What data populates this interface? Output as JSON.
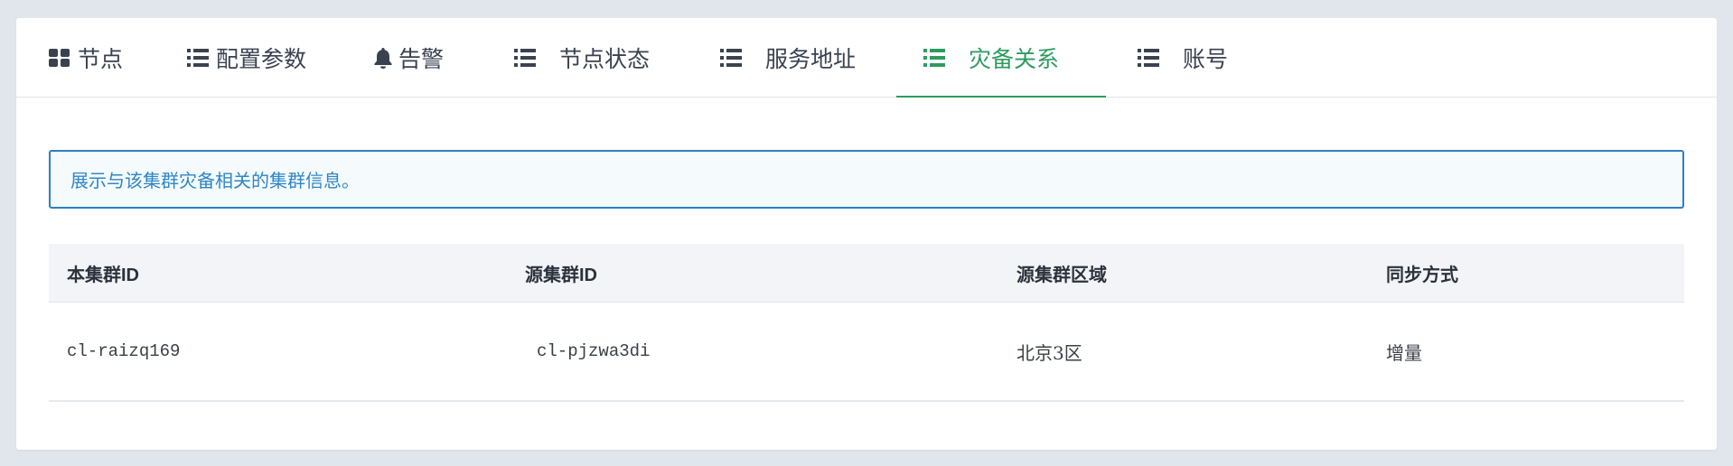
{
  "tabs": [
    {
      "label": "节点",
      "icon": "grid-icon",
      "active": false
    },
    {
      "label": "配置参数",
      "icon": "list-icon",
      "active": false
    },
    {
      "label": "告警",
      "icon": "bell-icon",
      "active": false
    },
    {
      "label": "节点状态",
      "icon": "list-icon",
      "active": false
    },
    {
      "label": "服务地址",
      "icon": "list-icon",
      "active": false
    },
    {
      "label": "灾备关系",
      "icon": "list-icon",
      "active": true
    },
    {
      "label": "账号",
      "icon": "list-icon",
      "active": false
    }
  ],
  "info": {
    "text": "展示与该集群灾备相关的集群信息。"
  },
  "table": {
    "columns": [
      "本集群ID",
      "源集群ID",
      "源集群区域",
      "同步方式"
    ],
    "rows": [
      [
        "cl-raizq169",
        "cl-pjzwa3di",
        "北京3区",
        "增量"
      ]
    ]
  },
  "colors": {
    "accent": "#2e9b5f",
    "info_border": "#2f7fc1",
    "info_text": "#2f86c8",
    "background": "#e1e6ec"
  }
}
